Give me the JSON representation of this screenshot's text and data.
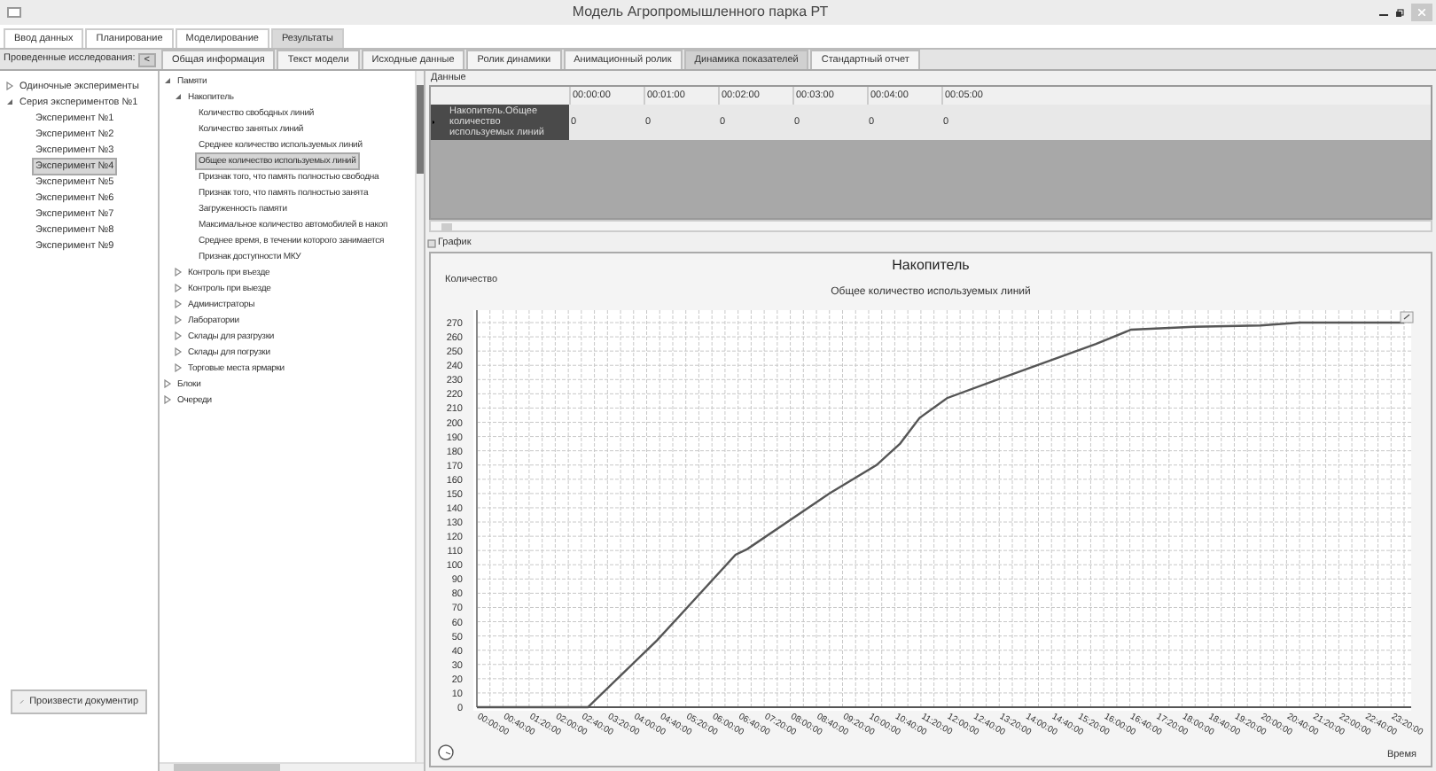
{
  "window": {
    "title": "Модель Агропромышленного парка РТ"
  },
  "main_tabs": [
    {
      "label": "Ввод данных",
      "selected": false
    },
    {
      "label": "Планирование",
      "selected": false
    },
    {
      "label": "Моделирование",
      "selected": false
    },
    {
      "label": "Результаты",
      "selected": true
    }
  ],
  "research_label": "Проведенные исследования:",
  "collapse_button": "<",
  "sub_tabs": [
    {
      "label": "Общая информация",
      "selected": false
    },
    {
      "label": "Текст модели",
      "selected": false
    },
    {
      "label": "Исходные данные",
      "selected": false
    },
    {
      "label": "Ролик динамики",
      "selected": false
    },
    {
      "label": "Анимационный ролик",
      "selected": false
    },
    {
      "label": "Динамика показателей",
      "selected": true
    },
    {
      "label": "Стандартный отчет",
      "selected": false
    }
  ],
  "experiments_tree": [
    {
      "label": "Одиночные эксперименты",
      "expanded": false,
      "selected": false
    },
    {
      "label": "Серия экспериментов №1",
      "expanded": true,
      "selected": false,
      "children": [
        {
          "label": "Эксперимент №1",
          "selected": false
        },
        {
          "label": "Эксперимент №2",
          "selected": false
        },
        {
          "label": "Эксперимент №3",
          "selected": false
        },
        {
          "label": "Эксперимент №4",
          "selected": true
        },
        {
          "label": "Эксперимент №5",
          "selected": false
        },
        {
          "label": "Эксперимент №6",
          "selected": false
        },
        {
          "label": "Эксперимент №7",
          "selected": false
        },
        {
          "label": "Эксперимент №8",
          "selected": false
        },
        {
          "label": "Эксперимент №9",
          "selected": false
        }
      ]
    }
  ],
  "document_button": "Произвести документир",
  "indicators_tree": [
    {
      "label": "Памяти",
      "expanded": true,
      "selected": false,
      "children": [
        {
          "label": "Накопитель",
          "expanded": true,
          "selected": false,
          "children": [
            {
              "label": "Количество свободных линий",
              "selected": false
            },
            {
              "label": "Количество занятых линий",
              "selected": false
            },
            {
              "label": "Среднее количество используемых линий",
              "selected": false
            },
            {
              "label": "Общее количество используемых линий",
              "selected": true
            },
            {
              "label": "Признак того, что память полностью свободна",
              "selected": false
            },
            {
              "label": "Признак того, что память полностью занята",
              "selected": false
            },
            {
              "label": "Загруженность памяти",
              "selected": false
            },
            {
              "label": "Максимальное количество автомобилей в накоп",
              "selected": false
            },
            {
              "label": "Среднее время, в течении которого занимается",
              "selected": false
            },
            {
              "label": "Признак доступности МКУ",
              "selected": false
            }
          ]
        },
        {
          "label": "Контроль при въезде",
          "expanded": false,
          "selected": false
        },
        {
          "label": "Контроль при выезде",
          "expanded": false,
          "selected": false
        },
        {
          "label": "Администраторы",
          "expanded": false,
          "selected": false
        },
        {
          "label": "Лаборатории",
          "expanded": false,
          "selected": false
        },
        {
          "label": "Склады для разгрузки",
          "expanded": false,
          "selected": false
        },
        {
          "label": "Склады для погрузки",
          "expanded": false,
          "selected": false
        },
        {
          "label": "Торговые места ярмарки",
          "expanded": false,
          "selected": false
        }
      ]
    },
    {
      "label": "Блоки",
      "expanded": false,
      "selected": false
    },
    {
      "label": "Очереди",
      "expanded": false,
      "selected": false
    }
  ],
  "data_panel": {
    "title": "Данные",
    "columns": [
      "00:00:00",
      "00:01:00",
      "00:02:00",
      "00:03:00",
      "00:04:00",
      "00:05:00"
    ],
    "rows": [
      {
        "header": "Накопитель.Общее количество используемых линий",
        "selected": true,
        "cells": [
          "0",
          "0",
          "0",
          "0",
          "0",
          "0"
        ]
      }
    ]
  },
  "chart_panel": {
    "title": "График",
    "chart_title": "Накопитель",
    "chart_data": {
      "type": "line",
      "title": "Общее количество используемых линий",
      "xlabel": "Время",
      "ylabel": "Количество",
      "x": [
        0,
        170,
        276,
        396,
        414,
        540,
        612,
        648,
        678,
        720,
        798,
        888,
        948,
        1002,
        1098,
        1200,
        1260,
        1420
      ],
      "series": [
        {
          "color": "#555555",
          "values": [
            0,
            0,
            47,
            107,
            111,
            150,
            170,
            185,
            203,
            217,
            230,
            245,
            255,
            265,
            267,
            268,
            270,
            270
          ]
        }
      ],
      "xlim": [
        0,
        1420
      ],
      "ylim": [
        0,
        270
      ],
      "grid": true,
      "xticks": [
        {
          "value": 0,
          "label": "00:00:00"
        },
        {
          "value": 40,
          "label": "00:40:00"
        },
        {
          "value": 80,
          "label": "01:20:00"
        },
        {
          "value": 120,
          "label": "02:00:00"
        },
        {
          "value": 160,
          "label": "02:40:00"
        },
        {
          "value": 200,
          "label": "03:20:00"
        },
        {
          "value": 240,
          "label": "04:00:00"
        },
        {
          "value": 280,
          "label": "04:40:00"
        },
        {
          "value": 320,
          "label": "05:20:00"
        },
        {
          "value": 360,
          "label": "06:00:00"
        },
        {
          "value": 400,
          "label": "06:40:00"
        },
        {
          "value": 440,
          "label": "07:20:00"
        },
        {
          "value": 480,
          "label": "08:00:00"
        },
        {
          "value": 520,
          "label": "08:40:00"
        },
        {
          "value": 560,
          "label": "09:20:00"
        },
        {
          "value": 600,
          "label": "10:00:00"
        },
        {
          "value": 640,
          "label": "10:40:00"
        },
        {
          "value": 680,
          "label": "11:20:00"
        },
        {
          "value": 720,
          "label": "12:00:00"
        },
        {
          "value": 760,
          "label": "12:40:00"
        },
        {
          "value": 800,
          "label": "13:20:00"
        },
        {
          "value": 840,
          "label": "14:00:00"
        },
        {
          "value": 880,
          "label": "14:40:00"
        },
        {
          "value": 920,
          "label": "15:20:00"
        },
        {
          "value": 960,
          "label": "16:00:00"
        },
        {
          "value": 1000,
          "label": "16:40:00"
        },
        {
          "value": 1040,
          "label": "17:20:00"
        },
        {
          "value": 1080,
          "label": "18:00:00"
        },
        {
          "value": 1120,
          "label": "18:40:00"
        },
        {
          "value": 1160,
          "label": "19:20:00"
        },
        {
          "value": 1200,
          "label": "20:00:00"
        },
        {
          "value": 1240,
          "label": "20:40:00"
        },
        {
          "value": 1280,
          "label": "21:20:00"
        },
        {
          "value": 1320,
          "label": "22:00:00"
        },
        {
          "value": 1360,
          "label": "22:40:00"
        },
        {
          "value": 1400,
          "label": "23:20:00"
        }
      ],
      "yticks": [
        0,
        10,
        20,
        30,
        40,
        50,
        60,
        70,
        80,
        90,
        100,
        110,
        120,
        130,
        140,
        150,
        160,
        170,
        180,
        190,
        200,
        210,
        220,
        230,
        240,
        250,
        260,
        270
      ]
    }
  }
}
